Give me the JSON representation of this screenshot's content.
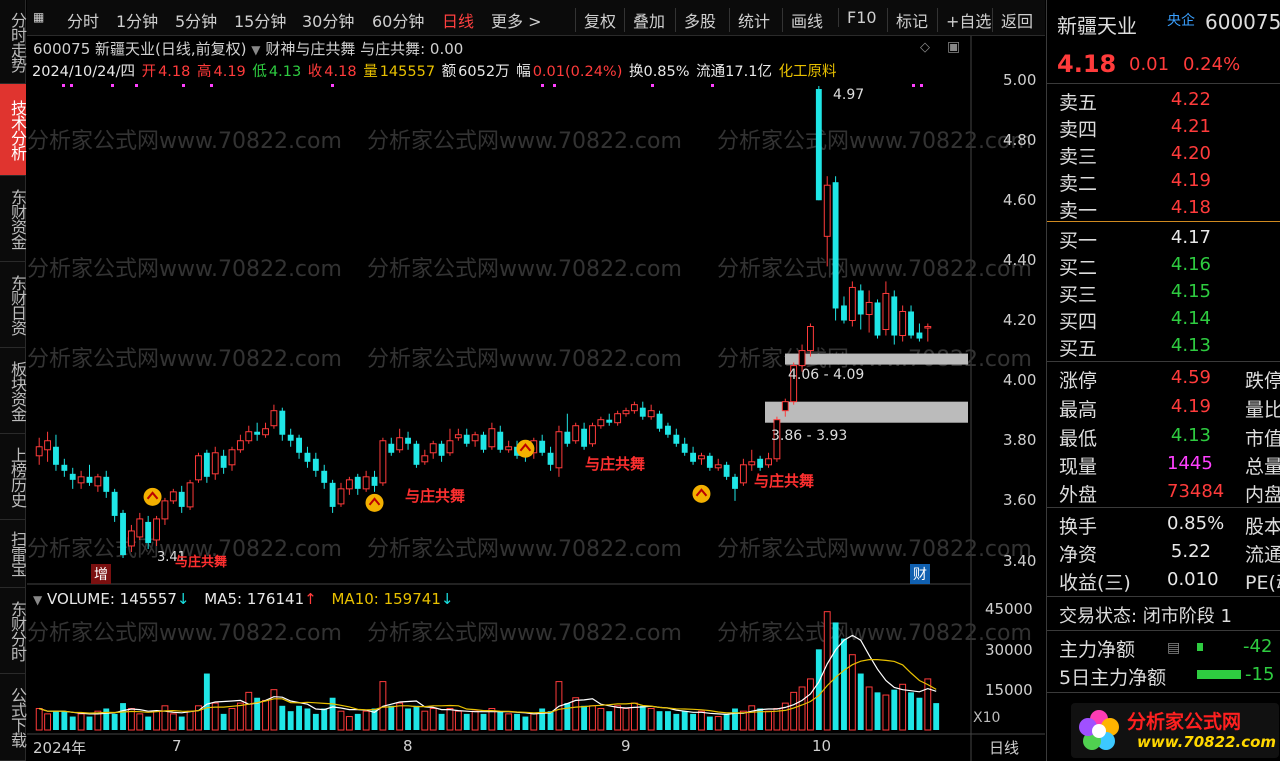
{
  "left_nav": [
    "分时走势",
    "技术分析",
    "东财资金",
    "东财日资",
    "板块资金",
    "上榜历史",
    "扫雷宝",
    "东财分时",
    "公式下载"
  ],
  "toolbar": {
    "periods": [
      "分时",
      "1分钟",
      "5分钟",
      "15分钟",
      "30分钟",
      "60分钟",
      "日线",
      "更多 >"
    ],
    "actions": [
      "复权",
      "叠加",
      "多股",
      "统计",
      "画线",
      "F10",
      "标记",
      "+自选",
      "返回"
    ]
  },
  "chart_header": {
    "title": "600075 新疆天业(日线,前复权)",
    "indicator": "财神与庄共舞 与庄共舞: 0.00",
    "date": "2024/10/24/四",
    "open_label": "开",
    "open": "4.18",
    "high_label": "高",
    "high": "4.19",
    "low_label": "低",
    "low": "4.13",
    "close_label": "收",
    "close": "4.18",
    "volume_label": "量",
    "volume": "145557",
    "amount_label": "额",
    "amount": "6052万",
    "change_label": "幅",
    "change": "0.01(0.24%)",
    "turnover": "换0.85%",
    "float_shares": "流通17.1亿",
    "sector": "化工原料"
  },
  "y_axis_labels": [
    "5.00",
    "4.80",
    "4.60",
    "4.40",
    "4.20",
    "4.00",
    "3.80",
    "3.60",
    "3.40"
  ],
  "vol_axis_labels": [
    "45000",
    "30000",
    "15000"
  ],
  "vol_scale_label": "X10",
  "x_axis_labels": [
    "2024年",
    "7",
    "8",
    "9",
    "10"
  ],
  "x_period_label": "日线",
  "annotations": {
    "peak": "4.97",
    "trough": "3.41",
    "zone1": "4.06 - 4.09",
    "zone2": "3.86 - 3.93",
    "signal_text": "与庄共舞",
    "marker_zeng": "增",
    "marker_cai": "财"
  },
  "volume_info": {
    "volume": "VOLUME: 145557",
    "ma5": "MA5: 176141",
    "ma10": "MA10: 159741"
  },
  "quote_panel": {
    "name": "新疆天业",
    "badge": "央企",
    "code": "600075",
    "price": "4.18",
    "change": "0.01",
    "pct": "0.24%",
    "asks": [
      {
        "label": "卖五",
        "price": "4.22"
      },
      {
        "label": "卖四",
        "price": "4.21"
      },
      {
        "label": "卖三",
        "price": "4.20"
      },
      {
        "label": "卖二",
        "price": "4.19"
      },
      {
        "label": "卖一",
        "price": "4.18"
      }
    ],
    "bids": [
      {
        "label": "买一",
        "price": "4.17"
      },
      {
        "label": "买二",
        "price": "4.16"
      },
      {
        "label": "买三",
        "price": "4.15"
      },
      {
        "label": "买四",
        "price": "4.14"
      },
      {
        "label": "买五",
        "price": "4.13"
      }
    ],
    "stats": [
      {
        "label": "涨停",
        "value": "4.59"
      },
      {
        "label": "最高",
        "value": "4.19"
      },
      {
        "label": "最低",
        "value": "4.13"
      },
      {
        "label": "现量",
        "value": "1445"
      },
      {
        "label": "外盘",
        "value": "73484"
      }
    ],
    "stats2": [
      "跌停",
      "量比",
      "市值",
      "总量",
      "内盘"
    ],
    "extra": [
      {
        "label": "换手",
        "value": "0.85%",
        "right": "股本"
      },
      {
        "label": "净资",
        "value": "5.22",
        "right": "流通"
      },
      {
        "label": "收益(三)",
        "value": "0.010",
        "right": "PE(动"
      }
    ],
    "trade_state": "交易状态: 闭市阶段 1",
    "main_flow": "主力净额",
    "main_flow_val": "-42",
    "main_flow5": "5日主力净额",
    "main_flow5_val": "-15"
  },
  "watermark": {
    "site": "分析家公式网",
    "url": "www.70822.com"
  },
  "chart_data": {
    "type": "candlestick",
    "y_range": [
      3.35,
      5.03
    ],
    "candles": [
      [
        3.78,
        3.75,
        3.81,
        3.72,
        "u"
      ],
      [
        3.77,
        3.8,
        3.83,
        3.73,
        "u"
      ],
      [
        3.78,
        3.72,
        3.82,
        3.7,
        "d"
      ],
      [
        3.72,
        3.7,
        3.74,
        3.68,
        "d"
      ],
      [
        3.69,
        3.67,
        3.71,
        3.64,
        "d"
      ],
      [
        3.66,
        3.68,
        3.7,
        3.64,
        "u"
      ],
      [
        3.68,
        3.66,
        3.72,
        3.65,
        "d"
      ],
      [
        3.65,
        3.68,
        3.69,
        3.63,
        "u"
      ],
      [
        3.68,
        3.63,
        3.7,
        3.61,
        "d"
      ],
      [
        3.63,
        3.55,
        3.64,
        3.53,
        "d"
      ],
      [
        3.56,
        3.42,
        3.57,
        3.41,
        "d"
      ],
      [
        3.45,
        3.5,
        3.52,
        3.43,
        "u"
      ],
      [
        3.48,
        3.54,
        3.56,
        3.47,
        "u"
      ],
      [
        3.53,
        3.46,
        3.55,
        3.44,
        "d"
      ],
      [
        3.47,
        3.54,
        3.55,
        3.45,
        "u"
      ],
      [
        3.54,
        3.6,
        3.61,
        3.52,
        "u"
      ],
      [
        3.6,
        3.63,
        3.64,
        3.59,
        "u"
      ],
      [
        3.63,
        3.58,
        3.65,
        3.56,
        "d"
      ],
      [
        3.58,
        3.66,
        3.67,
        3.57,
        "u"
      ],
      [
        3.67,
        3.75,
        3.76,
        3.66,
        "u"
      ],
      [
        3.76,
        3.68,
        3.77,
        3.66,
        "d"
      ],
      [
        3.69,
        3.76,
        3.78,
        3.67,
        "u"
      ],
      [
        3.75,
        3.71,
        3.77,
        3.69,
        "d"
      ],
      [
        3.72,
        3.77,
        3.78,
        3.7,
        "u"
      ],
      [
        3.77,
        3.8,
        3.82,
        3.76,
        "u"
      ],
      [
        3.8,
        3.83,
        3.85,
        3.79,
        "u"
      ],
      [
        3.83,
        3.82,
        3.86,
        3.8,
        "d"
      ],
      [
        3.82,
        3.84,
        3.86,
        3.81,
        "u"
      ],
      [
        3.85,
        3.9,
        3.92,
        3.84,
        "u"
      ],
      [
        3.9,
        3.82,
        3.91,
        3.8,
        "d"
      ],
      [
        3.82,
        3.8,
        3.84,
        3.78,
        "d"
      ],
      [
        3.81,
        3.76,
        3.82,
        3.74,
        "d"
      ],
      [
        3.76,
        3.73,
        3.78,
        3.71,
        "d"
      ],
      [
        3.74,
        3.7,
        3.76,
        3.68,
        "d"
      ],
      [
        3.7,
        3.66,
        3.72,
        3.64,
        "d"
      ],
      [
        3.66,
        3.58,
        3.67,
        3.56,
        "d"
      ],
      [
        3.59,
        3.64,
        3.66,
        3.58,
        "u"
      ],
      [
        3.64,
        3.67,
        3.68,
        3.62,
        "u"
      ],
      [
        3.68,
        3.64,
        3.69,
        3.62,
        "d"
      ],
      [
        3.64,
        3.68,
        3.7,
        3.63,
        "u"
      ],
      [
        3.68,
        3.65,
        3.7,
        3.63,
        "d"
      ],
      [
        3.66,
        3.8,
        3.81,
        3.65,
        "u"
      ],
      [
        3.79,
        3.76,
        3.81,
        3.75,
        "d"
      ],
      [
        3.77,
        3.81,
        3.84,
        3.76,
        "u"
      ],
      [
        3.81,
        3.79,
        3.83,
        3.77,
        "d"
      ],
      [
        3.79,
        3.72,
        3.8,
        3.71,
        "d"
      ],
      [
        3.73,
        3.75,
        3.77,
        3.72,
        "u"
      ],
      [
        3.76,
        3.79,
        3.8,
        3.74,
        "u"
      ],
      [
        3.79,
        3.75,
        3.8,
        3.73,
        "d"
      ],
      [
        3.76,
        3.8,
        3.84,
        3.75,
        "u"
      ],
      [
        3.81,
        3.82,
        3.84,
        3.8,
        "u"
      ],
      [
        3.82,
        3.79,
        3.84,
        3.78,
        "d"
      ],
      [
        3.8,
        3.82,
        3.83,
        3.78,
        "u"
      ],
      [
        3.82,
        3.77,
        3.83,
        3.76,
        "d"
      ],
      [
        3.78,
        3.84,
        3.86,
        3.77,
        "u"
      ],
      [
        3.83,
        3.77,
        3.85,
        3.76,
        "d"
      ],
      [
        3.77,
        3.78,
        3.8,
        3.76,
        "u"
      ],
      [
        3.78,
        3.75,
        3.8,
        3.74,
        "d"
      ],
      [
        3.76,
        3.75,
        3.78,
        3.73,
        "d"
      ],
      [
        3.76,
        3.8,
        3.81,
        3.74,
        "u"
      ],
      [
        3.8,
        3.76,
        3.82,
        3.75,
        "d"
      ],
      [
        3.76,
        3.72,
        3.78,
        3.7,
        "d"
      ],
      [
        3.71,
        3.83,
        3.85,
        3.68,
        "u"
      ],
      [
        3.83,
        3.79,
        3.89,
        3.78,
        "d"
      ],
      [
        3.8,
        3.85,
        3.86,
        3.79,
        "u"
      ],
      [
        3.84,
        3.78,
        3.86,
        3.77,
        "d"
      ],
      [
        3.79,
        3.85,
        3.86,
        3.78,
        "u"
      ],
      [
        3.85,
        3.87,
        3.88,
        3.84,
        "u"
      ],
      [
        3.87,
        3.86,
        3.89,
        3.85,
        "d"
      ],
      [
        3.86,
        3.89,
        3.9,
        3.85,
        "u"
      ],
      [
        3.89,
        3.9,
        3.91,
        3.88,
        "u"
      ],
      [
        3.9,
        3.92,
        3.93,
        3.89,
        "u"
      ],
      [
        3.91,
        3.88,
        3.93,
        3.87,
        "d"
      ],
      [
        3.88,
        3.9,
        3.92,
        3.87,
        "u"
      ],
      [
        3.89,
        3.84,
        3.9,
        3.83,
        "d"
      ],
      [
        3.85,
        3.82,
        3.86,
        3.81,
        "d"
      ],
      [
        3.82,
        3.79,
        3.84,
        3.78,
        "d"
      ],
      [
        3.79,
        3.76,
        3.81,
        3.75,
        "d"
      ],
      [
        3.76,
        3.73,
        3.78,
        3.72,
        "d"
      ],
      [
        3.74,
        3.75,
        3.76,
        3.72,
        "u"
      ],
      [
        3.75,
        3.71,
        3.76,
        3.7,
        "d"
      ],
      [
        3.71,
        3.72,
        3.74,
        3.7,
        "u"
      ],
      [
        3.72,
        3.68,
        3.73,
        3.67,
        "d"
      ],
      [
        3.68,
        3.64,
        3.69,
        3.6,
        "d"
      ],
      [
        3.66,
        3.72,
        3.74,
        3.65,
        "u"
      ],
      [
        3.72,
        3.73,
        3.77,
        3.7,
        "u"
      ],
      [
        3.74,
        3.71,
        3.75,
        3.7,
        "d"
      ],
      [
        3.72,
        3.74,
        3.76,
        3.71,
        "u"
      ],
      [
        3.74,
        3.87,
        3.88,
        3.73,
        "u"
      ],
      [
        3.9,
        3.93,
        3.94,
        3.88,
        "u"
      ],
      [
        3.93,
        4.05,
        4.06,
        3.92,
        "u"
      ],
      [
        4.05,
        4.1,
        4.12,
        4.03,
        "u"
      ],
      [
        4.1,
        4.18,
        4.19,
        4.08,
        "u"
      ],
      [
        4.6,
        4.97,
        4.98,
        4.6,
        "d"
      ],
      [
        4.48,
        4.65,
        4.68,
        4.38,
        "u"
      ],
      [
        4.66,
        4.24,
        4.68,
        4.2,
        "d"
      ],
      [
        4.25,
        4.2,
        4.28,
        4.19,
        "d"
      ],
      [
        4.2,
        4.31,
        4.33,
        4.18,
        "u"
      ],
      [
        4.3,
        4.22,
        4.32,
        4.17,
        "d"
      ],
      [
        4.22,
        4.26,
        4.3,
        4.16,
        "u"
      ],
      [
        4.26,
        4.15,
        4.27,
        4.14,
        "d"
      ],
      [
        4.17,
        4.29,
        4.33,
        4.15,
        "u"
      ],
      [
        4.28,
        4.15,
        4.3,
        4.12,
        "d"
      ],
      [
        4.15,
        4.23,
        4.25,
        4.13,
        "u"
      ],
      [
        4.23,
        4.15,
        4.25,
        4.14,
        "d"
      ],
      [
        4.16,
        4.14,
        4.19,
        4.13,
        "d"
      ],
      [
        4.18,
        4.18,
        4.19,
        4.13,
        "u"
      ]
    ],
    "volumes": [
      8,
      6,
      7,
      7,
      5,
      6,
      5,
      7,
      8,
      6,
      10,
      8,
      6,
      5,
      7,
      9,
      6,
      5,
      7,
      9,
      21,
      10,
      6,
      8,
      10,
      14,
      12,
      11,
      15,
      9,
      7,
      9,
      8,
      6,
      8,
      12,
      7,
      5,
      6,
      7,
      8,
      18,
      9,
      10,
      8,
      9,
      7,
      8,
      6,
      8,
      7,
      6,
      7,
      6,
      8,
      7,
      6,
      6,
      5,
      6,
      8,
      7,
      18,
      10,
      12,
      9,
      9,
      8,
      7,
      9,
      8,
      10,
      9,
      8,
      7,
      7,
      6,
      7,
      6,
      7,
      5,
      5,
      6,
      8,
      7,
      9,
      8,
      7,
      8,
      10,
      14,
      16,
      19,
      30,
      44,
      40,
      34,
      28,
      21,
      16,
      14,
      13,
      15,
      17,
      14,
      12,
      19,
      10
    ]
  }
}
